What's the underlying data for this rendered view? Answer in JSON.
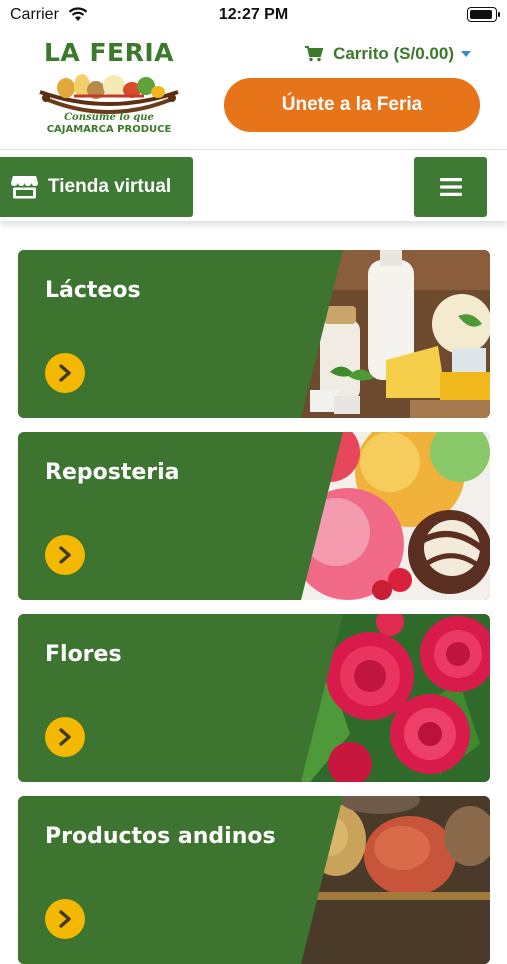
{
  "status_bar": {
    "carrier": "Carrier",
    "time": "12:27 PM",
    "battery_level": 0.95
  },
  "header": {
    "logo": {
      "title": "LA FERIA",
      "tagline": "Consume lo que",
      "tagline2": "CAJAMARCA PRODUCE"
    },
    "cart_label": "Carrito (S/0.00)",
    "join_button": "Únete a la Feria"
  },
  "nav": {
    "store_label": "Tienda virtual",
    "menu_icon": "hamburger-icon"
  },
  "colors": {
    "brand_green": "#3f7a34",
    "brand_orange": "#e8741a",
    "arrow_yellow": "#f5b800"
  },
  "categories": [
    {
      "label": "Lácteos",
      "image": "dairy-image"
    },
    {
      "label": "Reposteria",
      "image": "ice-cream-image"
    },
    {
      "label": "Flores",
      "image": "roses-image"
    },
    {
      "label": "Productos andinos",
      "image": "potatoes-image"
    }
  ]
}
